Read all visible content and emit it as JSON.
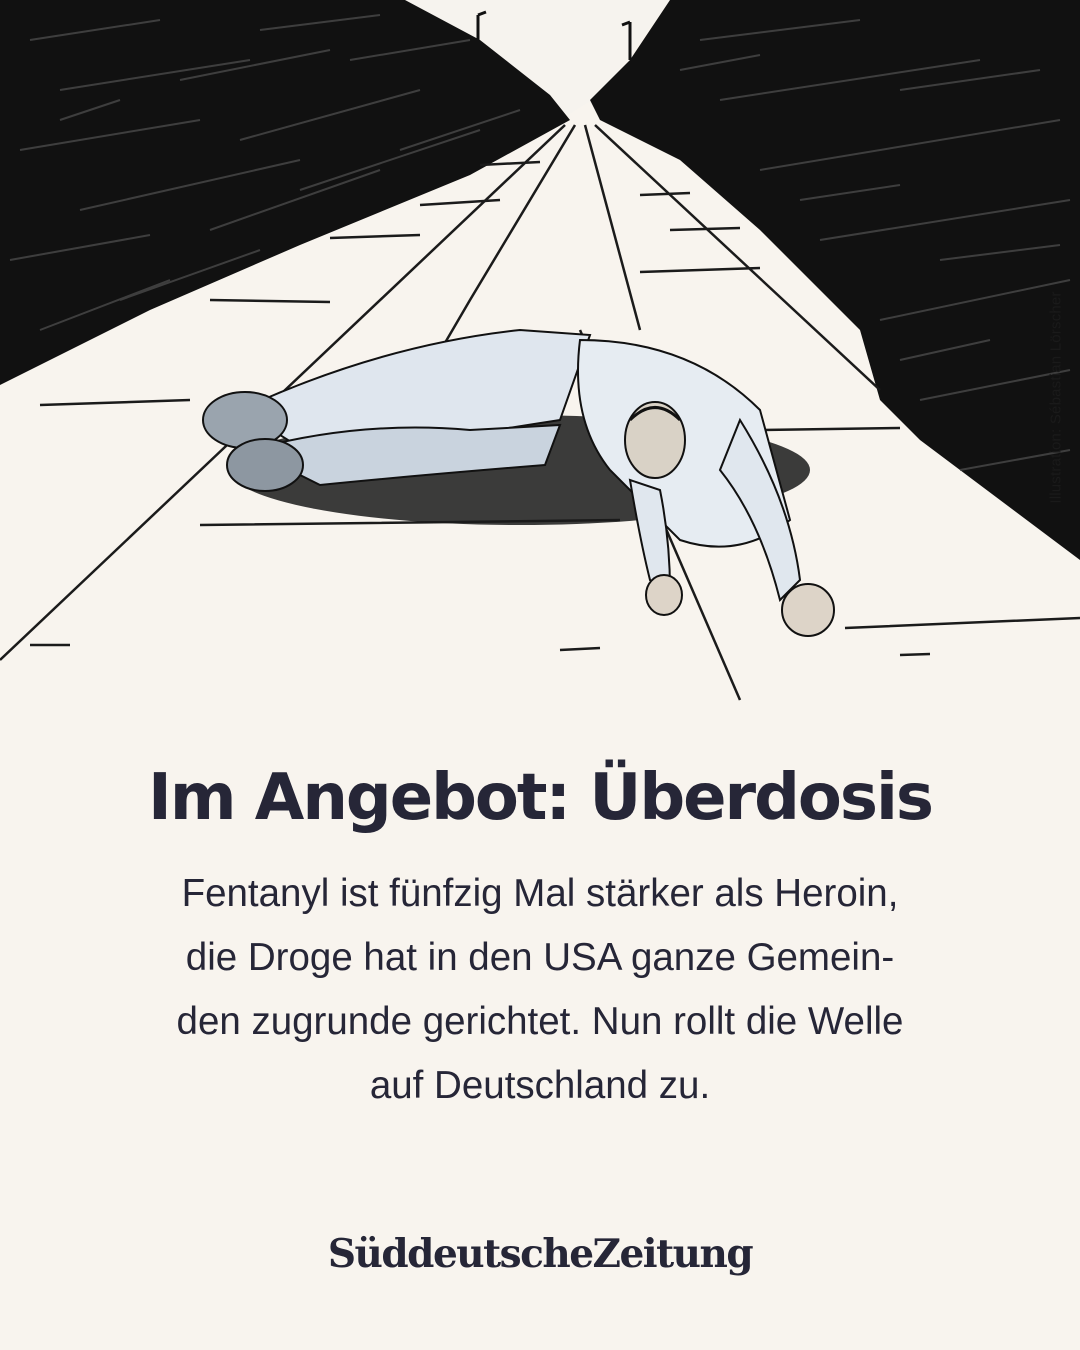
{
  "illustration": {
    "subject": "person-lying-on-street-illustration",
    "credit": "Illustration: Sébastian Lörscher"
  },
  "headline": "Im Angebot: Überdosis",
  "teaser_lines": [
    "Fentanyl ist fünfzig Mal stärker als Heroin,",
    "die Droge hat in den USA ganze Gemein-",
    "den zugrunde gerichtet. Nun rollt die Welle",
    "auf Deutschland zu."
  ],
  "brand": {
    "logo_text": "SüddeutscheZeitung"
  },
  "colors": {
    "background": "#f8f4ee",
    "text": "#262637",
    "ink": "#111111"
  }
}
